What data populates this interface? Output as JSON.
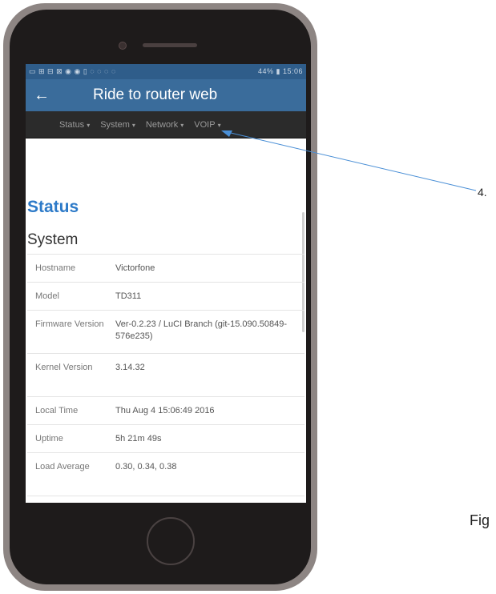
{
  "status_bar": {
    "left_icons": "▭ ⊞ ⊟ ⊠ ◉ ◉ ▯ ◌ ◌ ◌ ◌",
    "battery": "44%",
    "time": "15:06"
  },
  "app": {
    "title": "Ride to router web"
  },
  "nav": {
    "items": [
      "Status",
      "System",
      "Network",
      "VOIP"
    ]
  },
  "page": {
    "title": "Status",
    "section": "System",
    "rows": [
      {
        "key": "Hostname",
        "value": "Victorfone"
      },
      {
        "key": "Model",
        "value": "TD311"
      },
      {
        "key": "Firmware Version",
        "value": "Ver-0.2.23 / LuCI Branch (git-15.090.50849-576e235)"
      },
      {
        "key": "Kernel Version",
        "value": "3.14.32"
      },
      {
        "key": "Local Time",
        "value": "Thu Aug 4 15:06:49 2016"
      },
      {
        "key": "Uptime",
        "value": "5h 21m 49s"
      },
      {
        "key": "Load Average",
        "value": "0.30, 0.34, 0.38"
      }
    ]
  },
  "annotation": {
    "callout_number": "4.",
    "figure_label": "Fig"
  },
  "colors": {
    "appbar": "#3a6c9b",
    "navbar": "#2b2b2b",
    "title_blue": "#2d7ac8",
    "callout_line": "#4a8fd6"
  }
}
